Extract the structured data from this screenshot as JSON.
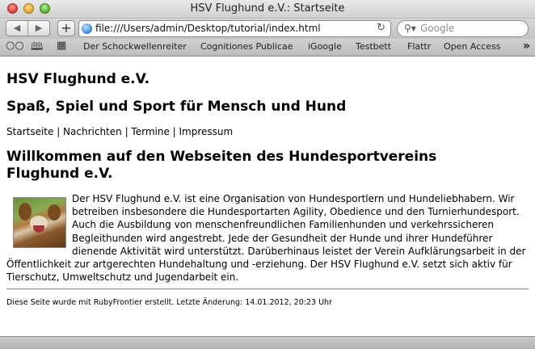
{
  "window": {
    "title": "HSV Flughund e.V.: Startseite"
  },
  "toolbar": {
    "back_glyph": "◀",
    "forward_glyph": "▶",
    "add_glyph": "+",
    "url": "file:///Users/admin/Desktop/tutorial/index.html",
    "reload_glyph": "↻",
    "search_placeholder": "Google",
    "search_icon": "magnifier-icon"
  },
  "bookmarks": {
    "items": [
      "Der Schockwellenreiter",
      "Cognitiones Publicae",
      "iGoogle",
      "Testbett",
      "Flattr",
      "Open Access"
    ],
    "more_glyph": "»",
    "reader_glyph": "👓",
    "book_glyph": "📖",
    "grid_glyph": "▦"
  },
  "page": {
    "title": "HSV Flughund e.V.",
    "subtitle": "Spaß, Spiel und Sport für Mensch und Hund",
    "nav": {
      "items": [
        "Startseite",
        "Nachrichten",
        "Termine",
        "Impressum"
      ],
      "separator": " | "
    },
    "heading": "Willkommen auf den Webseiten des Hundesportvereins Flughund e.V.",
    "paragraph_lines": [
      "Der HSV Flughund e.V. ist eine Organisation von Hundesportlern und Hundeliebhabern. Wir",
      "betreiben insbesondere die Hundesportarten Agility, Obedience und den Turnierhundesport.",
      "Auch die Ausbildung von menschenfreundlichen Familienhunden und verkehrssicheren",
      "Begleithunden wird angestrebt. Jede der Gesundheit der Hunde und ihrer Hundeführer",
      "dienende Aktivität wird unterstützt. Darüberhinaus leistet der Verein Aufklärungsarbeit in der",
      "Öffentlichkeit zur artgerechten Hundehaltung und -erziehung. Der HSV Flughund e.V. setzt sich aktiv für",
      "Tierschutz, Umweltschutz und Jugendarbeit ein."
    ],
    "footer": "Diese Seite wurde mit RubyFrontier erstellt. Letzte Änderung: 14.01.2012, 20:23 Uhr"
  }
}
